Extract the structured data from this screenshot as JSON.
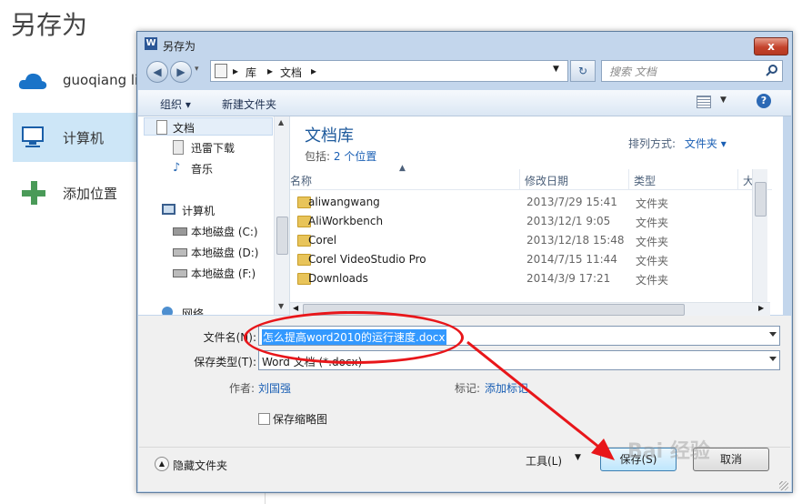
{
  "backstage": {
    "title": "另存为",
    "items": [
      {
        "label": "guoqiang li"
      },
      {
        "label": "计算机"
      },
      {
        "label": "添加位置"
      }
    ]
  },
  "dialog": {
    "title": "另存为",
    "close": "x",
    "address": {
      "segments": [
        "库",
        "文档"
      ]
    },
    "search_placeholder": "搜索 文档",
    "toolbar": {
      "organize": "组织 ▾",
      "new_folder": "新建文件夹"
    },
    "nav": {
      "items": [
        "文档",
        "迅雷下载",
        "音乐",
        "计算机",
        "本地磁盘 (C:)",
        "本地磁盘 (D:)",
        "本地磁盘 (F:)",
        "网络"
      ]
    },
    "library": {
      "title": "文档库",
      "includes_label": "包括:",
      "includes_link": "2 个位置",
      "arrange_label": "排列方式:",
      "arrange_value": "文件夹 ▾"
    },
    "columns": [
      "名称",
      "修改日期",
      "类型",
      "大"
    ],
    "files": [
      {
        "name": "aliwangwang",
        "date": "2013/7/29 15:41",
        "type": "文件夹"
      },
      {
        "name": "AliWorkbench",
        "date": "2013/12/1 9:05",
        "type": "文件夹"
      },
      {
        "name": "Corel",
        "date": "2013/12/18 15:48",
        "type": "文件夹"
      },
      {
        "name": "Corel VideoStudio Pro",
        "date": "2014/7/15 11:44",
        "type": "文件夹"
      },
      {
        "name": "Downloads",
        "date": "2014/3/9 17:21",
        "type": "文件夹"
      }
    ],
    "form": {
      "filename_label": "文件名(N):",
      "filename_value": "怎么提高word2010的运行速度.docx",
      "filetype_label": "保存类型(T):",
      "filetype_value": "Word 文档 (*.docx)",
      "author_label": "作者:",
      "author_value": "刘国强",
      "tags_label": "标记:",
      "tags_value": "添加标记",
      "thumbnail_label": "保存缩略图"
    },
    "footer": {
      "hide_folders": "隐藏文件夹",
      "tools": "工具(L)",
      "save": "保存(S)",
      "cancel": "取消"
    }
  },
  "colors": {
    "annotation": "#e8161a",
    "link": "#1a5fb4",
    "selection": "#3399ff"
  },
  "watermark": "Bai 经验"
}
